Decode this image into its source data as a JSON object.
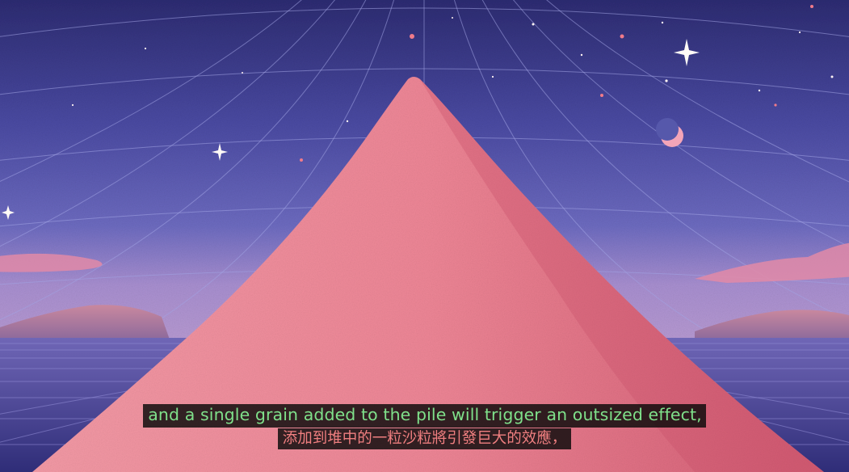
{
  "video": {
    "colors": {
      "sky_top": "#2d2c72",
      "sky_mid": "#5a5bb0",
      "sky_horizon": "#a88fd0",
      "pile": "#ec7d8e",
      "pile_shadow": "#d2566e",
      "mountains": "#b47a9e",
      "sea": "#3b3a86",
      "grid_line": "#9d9ee0",
      "stars": "#fff4f4",
      "moon": "#f4a0b8"
    }
  },
  "captions": {
    "english": "and a single grain added to the pile will trigger an outsized effect,",
    "chinese": "添加到堆中的一粒沙粒將引發巨大的效應，",
    "english_color": "#7fe08a",
    "chinese_color": "#f07f80"
  }
}
